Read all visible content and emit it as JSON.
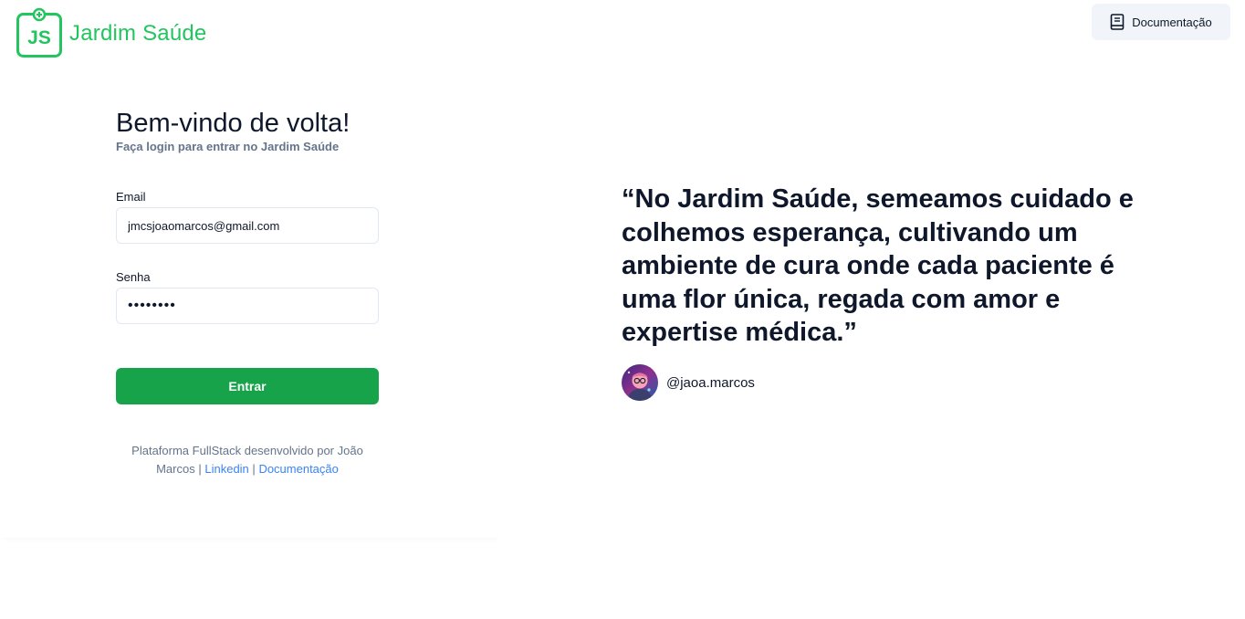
{
  "brand": {
    "logo_initials": "JS",
    "name": "Jardim Saúde",
    "color": "#22c55e"
  },
  "header": {
    "doc_button_label": "Documentação",
    "doc_icon": "book-icon"
  },
  "login": {
    "title": "Bem-vindo de volta!",
    "subtitle": "Faça login para entrar no Jardim Saúde",
    "email_label": "Email",
    "email_value": "jmcsjoaomarcos@gmail.com",
    "password_label": "Senha",
    "password_value": "jmcs1234",
    "submit_label": "Entrar",
    "submit_color": "#16a34a"
  },
  "footer": {
    "text": "Plataforma FullStack desenvolvido por João Marcos",
    "separator": "|",
    "linkedin_label": "Linkedin",
    "docs_label": "Documentação",
    "link_color": "#3b82f6"
  },
  "testimonial": {
    "quote": "“No Jardim Saúde, semeamos cuidado e colhemos esperança, cultivando um ambiente de cura onde cada paciente é uma flor única, regada com amor e expertise médica.”",
    "author_handle": "@jaoa.marcos"
  }
}
